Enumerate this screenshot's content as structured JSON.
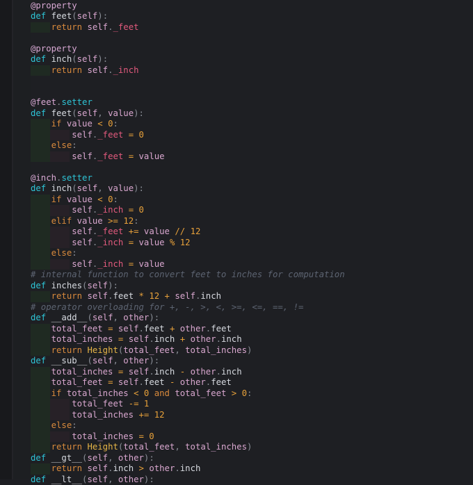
{
  "editor": {
    "language": "python",
    "lines": [
      "@property",
      "def feet(self):",
      "    return self._feet",
      "",
      "@property",
      "def inch(self):",
      "    return self._inch",
      "",
      "",
      "@feet.setter",
      "def feet(self, value):",
      "    if value < 0:",
      "        self._feet = 0",
      "    else:",
      "        self._feet = value",
      "",
      "@inch.setter",
      "def inch(self, value):",
      "    if value < 0:",
      "        self._inch = 0",
      "    elif value >= 12:",
      "        self._feet += value // 12",
      "        self._inch = value % 12",
      "    else:",
      "        self._inch = value",
      "# internal function to convert feet to inches for computation",
      "def inches(self):",
      "    return self.feet * 12 + self.inch",
      "# operator overloading for +, -, >, <, >=, <=, ==, !=",
      "def __add__(self, other):",
      "    total_feet = self.feet + other.feet",
      "    total_inches = self.inch + other.inch",
      "    return Height(total_feet, total_inches)",
      "def __sub__(self, other):",
      "    total_inches = self.inch - other.inch",
      "    total_feet = self.feet - other.feet",
      "    if total_inches < 0 and total_feet > 0:",
      "        total_feet -= 1",
      "        total_inches += 12",
      "    else:",
      "        total_inches = 0",
      "    return Height(total_feet, total_inches)",
      "def __gt__(self, other):",
      "    return self.inch > other.inch",
      "def __lt__(self, other):"
    ]
  },
  "colors": {
    "background": "#1e1f23",
    "keyword": "#2ec4d6",
    "self": "#d9a7cf",
    "private_attr": "#e25a7d",
    "number_operator": "#e8a13a",
    "comment": "#5d6472",
    "class_name": "#e6b547"
  }
}
